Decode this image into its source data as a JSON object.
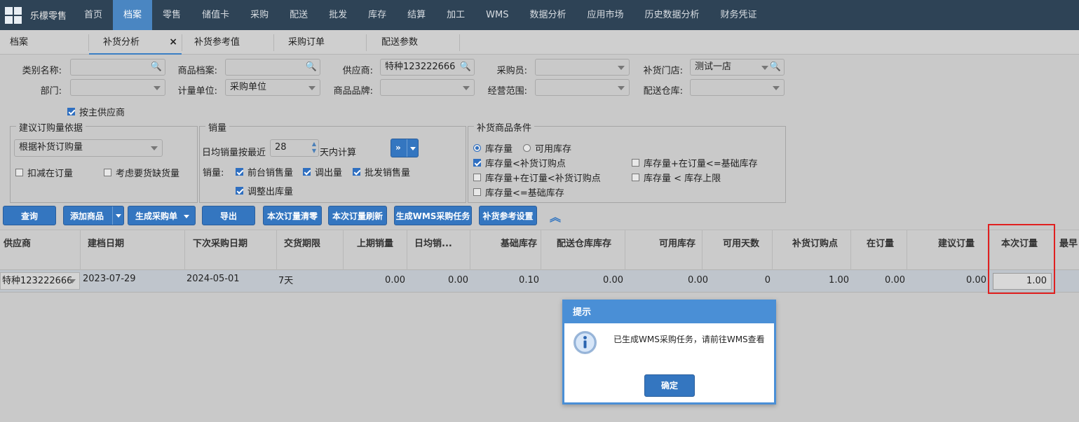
{
  "nav": {
    "brand": "乐檬零售",
    "items": [
      "首页",
      "档案",
      "零售",
      "储值卡",
      "采购",
      "配送",
      "批发",
      "库存",
      "结算",
      "加工",
      "WMS",
      "数据分析",
      "应用市场",
      "历史数据分析",
      "财务凭证"
    ],
    "active_index": 1
  },
  "tabs": {
    "items": [
      "档案",
      "补货分析",
      "补货参考值",
      "采购订单",
      "配送参数"
    ],
    "close": "×"
  },
  "form": {
    "category_label": "类别名称:",
    "product_label": "商品档案:",
    "supplier_label": "供应商:",
    "supplier_value": "特种123222666",
    "buyer_label": "采购员:",
    "store_label": "补货门店:",
    "store_value": "测试一店",
    "dept_label": "部门:",
    "unit_label": "计量单位:",
    "unit_value": "采购单位",
    "brand_label": "商品品牌:",
    "scope_label": "经营范围:",
    "warehouse_label": "配送仓库:",
    "by_main_supplier": "按主供应商"
  },
  "basis": {
    "legend": "建议订购量依据",
    "select_value": "根据补货订购量",
    "deduct_on_order": "扣减在订量",
    "consider_shortage": "考虑要货缺货量"
  },
  "sales": {
    "legend": "销量",
    "daily_prefix": "日均销量按最近",
    "days_value": "28",
    "daily_suffix": "天内计算",
    "sales_label": "销量:",
    "front_sales": "前台销售量",
    "transfer_out": "调出量",
    "wholesale": "批发销售量",
    "adjust_out": "调整出库量",
    "arrow_btn": "»"
  },
  "conditions": {
    "legend": "补货商品条件",
    "radio_stock": "库存量",
    "radio_available": "可用库存",
    "c1": "库存量<补货订购点",
    "c2": "库存量+在订量<补货订购点",
    "c3": "库存量<=基础库存",
    "c4": "库存量+在订量<=基础库存",
    "c5": "库存量 < 库存上限"
  },
  "toolbar": {
    "query": "查询",
    "add_product": "添加商品",
    "gen_po": "生成采购单",
    "export": "导出",
    "clear_qty": "本次订量清零",
    "refresh_qty": "本次订量刷新",
    "gen_wms": "生成WMS采购任务",
    "ref_settings": "补货参考设置",
    "collapse": "︽"
  },
  "grid": {
    "headers": [
      "供应商",
      "建档日期",
      "下次采购日期",
      "交货期限",
      "上期销量",
      "日均销...",
      "基础库存",
      "配送仓库库存",
      "可用库存",
      "可用天数",
      "补货订购点",
      "在订量",
      "建议订量",
      "本次订量",
      "最早"
    ],
    "row": [
      "特种123222666",
      "2023-07-29",
      "2024-05-01",
      "7天",
      "0.00",
      "0.00",
      "0.10",
      "0.00",
      "0.00",
      "0",
      "1.00",
      "0.00",
      "0.00",
      "1.00"
    ]
  },
  "modal": {
    "title": "提示",
    "message": "已生成WMS采购任务，请前往WMS查看",
    "ok": "确定"
  },
  "colors": {
    "nav_bg": "#2e4356",
    "accent": "#3476c0",
    "highlight_border": "#e02020"
  }
}
